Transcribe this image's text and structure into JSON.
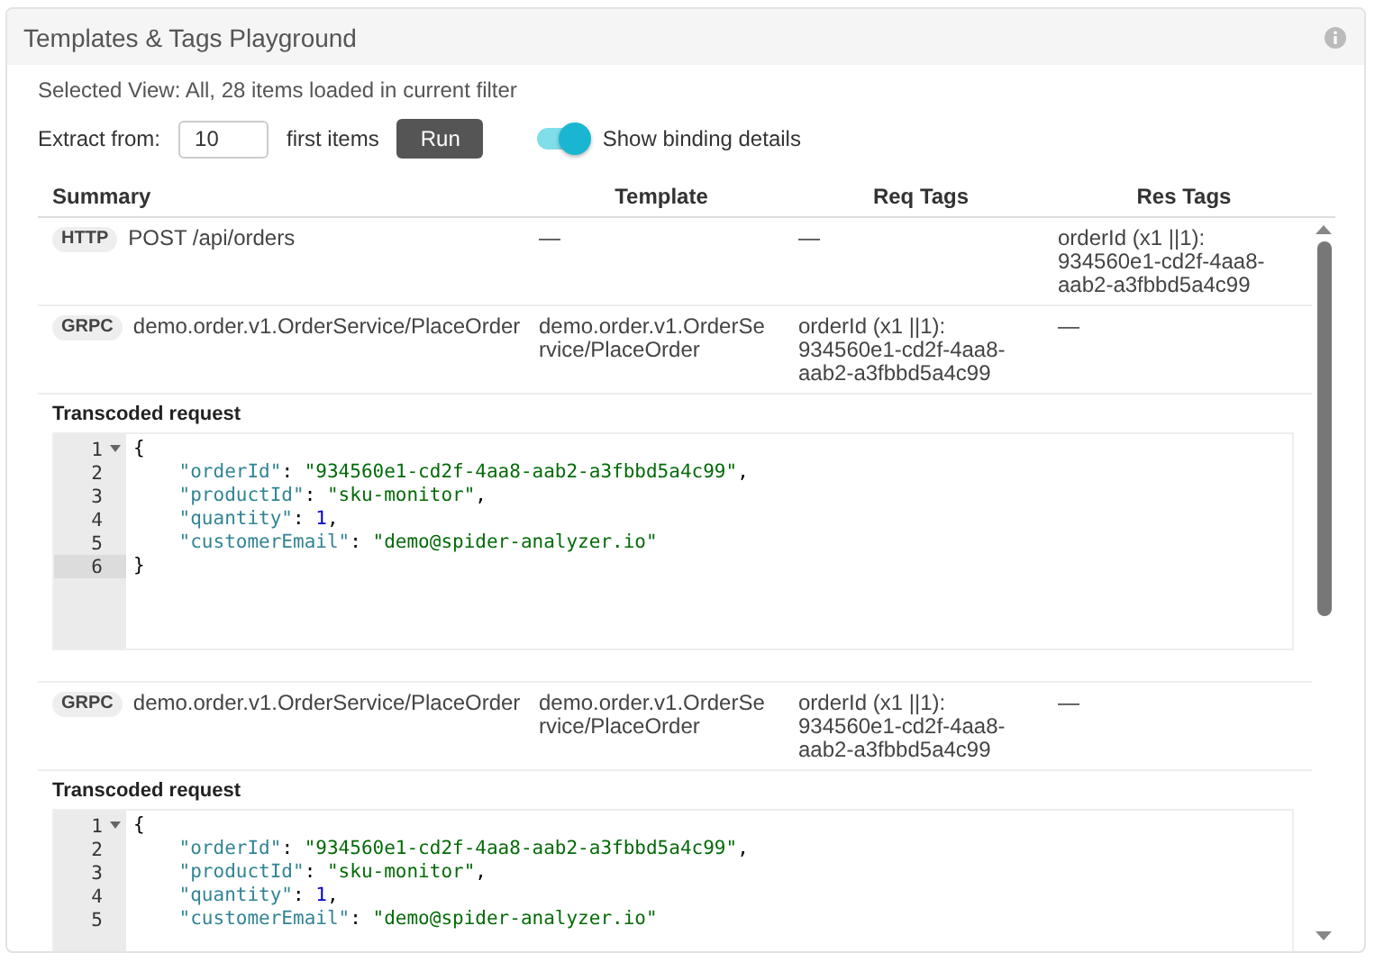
{
  "panel": {
    "title": "Templates & Tags Playground"
  },
  "selected_view": "Selected View: All, 28 items loaded in current filter",
  "extract": {
    "label": "Extract from:",
    "value": "10",
    "suffix": "first items",
    "button": "Run"
  },
  "binding_toggle": {
    "label": "Show binding details",
    "on": true
  },
  "table": {
    "columns": [
      "Summary",
      "Template",
      "Req Tags",
      "Res Tags"
    ],
    "rows": [
      {
        "protocol": "HTTP",
        "summary": "POST /api/orders",
        "template": "—",
        "req_tags": "—",
        "res_tags": "orderId (x1 ||1): 934560e1-cd2f-4aa8-aab2-a3fbbd5a4c99"
      },
      {
        "protocol": "GRPC",
        "summary": "demo.order.v1.OrderService/PlaceOrder",
        "template": "demo.order.v1.OrderService/PlaceOrder",
        "req_tags": "orderId (x1 ||1): 934560e1-cd2f-4aa8-aab2-a3fbbd5a4c99",
        "res_tags": "—",
        "detail": {
          "title": "Transcoded request",
          "lines": [
            {
              "number": "1",
              "foldable": true,
              "active": false,
              "tokens": [
                {
                  "kind": "punct",
                  "text": "{"
                }
              ]
            },
            {
              "number": "2",
              "foldable": false,
              "active": false,
              "tokens": [
                {
                  "kind": "key",
                  "text": "    \"orderId\""
                },
                {
                  "kind": "punct",
                  "text": ": "
                },
                {
                  "kind": "string",
                  "text": "\"934560e1-cd2f-4aa8-aab2-a3fbbd5a4c99\""
                },
                {
                  "kind": "punct",
                  "text": ","
                }
              ]
            },
            {
              "number": "3",
              "foldable": false,
              "active": false,
              "tokens": [
                {
                  "kind": "key",
                  "text": "    \"productId\""
                },
                {
                  "kind": "punct",
                  "text": ": "
                },
                {
                  "kind": "string",
                  "text": "\"sku-monitor\""
                },
                {
                  "kind": "punct",
                  "text": ","
                }
              ]
            },
            {
              "number": "4",
              "foldable": false,
              "active": false,
              "tokens": [
                {
                  "kind": "key",
                  "text": "    \"quantity\""
                },
                {
                  "kind": "punct",
                  "text": ": "
                },
                {
                  "kind": "number",
                  "text": "1"
                },
                {
                  "kind": "punct",
                  "text": ","
                }
              ]
            },
            {
              "number": "5",
              "foldable": false,
              "active": false,
              "tokens": [
                {
                  "kind": "key",
                  "text": "    \"customerEmail\""
                },
                {
                  "kind": "punct",
                  "text": ": "
                },
                {
                  "kind": "string",
                  "text": "\"demo@spider-analyzer.io\""
                }
              ]
            },
            {
              "number": "6",
              "foldable": false,
              "active": true,
              "tokens": [
                {
                  "kind": "punct",
                  "text": "}"
                }
              ]
            }
          ]
        }
      },
      {
        "protocol": "GRPC",
        "summary": "demo.order.v1.OrderService/PlaceOrder",
        "template": "demo.order.v1.OrderService/PlaceOrder",
        "req_tags": "orderId (x1 ||1): 934560e1-cd2f-4aa8-aab2-a3fbbd5a4c99",
        "res_tags": "—",
        "detail": {
          "title": "Transcoded request",
          "lines": [
            {
              "number": "1",
              "foldable": true,
              "active": false,
              "tokens": [
                {
                  "kind": "punct",
                  "text": "{"
                }
              ]
            },
            {
              "number": "2",
              "foldable": false,
              "active": false,
              "tokens": [
                {
                  "kind": "key",
                  "text": "    \"orderId\""
                },
                {
                  "kind": "punct",
                  "text": ": "
                },
                {
                  "kind": "string",
                  "text": "\"934560e1-cd2f-4aa8-aab2-a3fbbd5a4c99\""
                },
                {
                  "kind": "punct",
                  "text": ","
                }
              ]
            },
            {
              "number": "3",
              "foldable": false,
              "active": false,
              "tokens": [
                {
                  "kind": "key",
                  "text": "    \"productId\""
                },
                {
                  "kind": "punct",
                  "text": ": "
                },
                {
                  "kind": "string",
                  "text": "\"sku-monitor\""
                },
                {
                  "kind": "punct",
                  "text": ","
                }
              ]
            },
            {
              "number": "4",
              "foldable": false,
              "active": false,
              "tokens": [
                {
                  "kind": "key",
                  "text": "    \"quantity\""
                },
                {
                  "kind": "punct",
                  "text": ": "
                },
                {
                  "kind": "number",
                  "text": "1"
                },
                {
                  "kind": "punct",
                  "text": ","
                }
              ]
            },
            {
              "number": "5",
              "foldable": false,
              "active": false,
              "tokens": [
                {
                  "kind": "key",
                  "text": "    \"customerEmail\""
                },
                {
                  "kind": "punct",
                  "text": ": "
                },
                {
                  "kind": "string",
                  "text": "\"demo@spider-analyzer.io\""
                }
              ]
            }
          ]
        }
      }
    ]
  }
}
